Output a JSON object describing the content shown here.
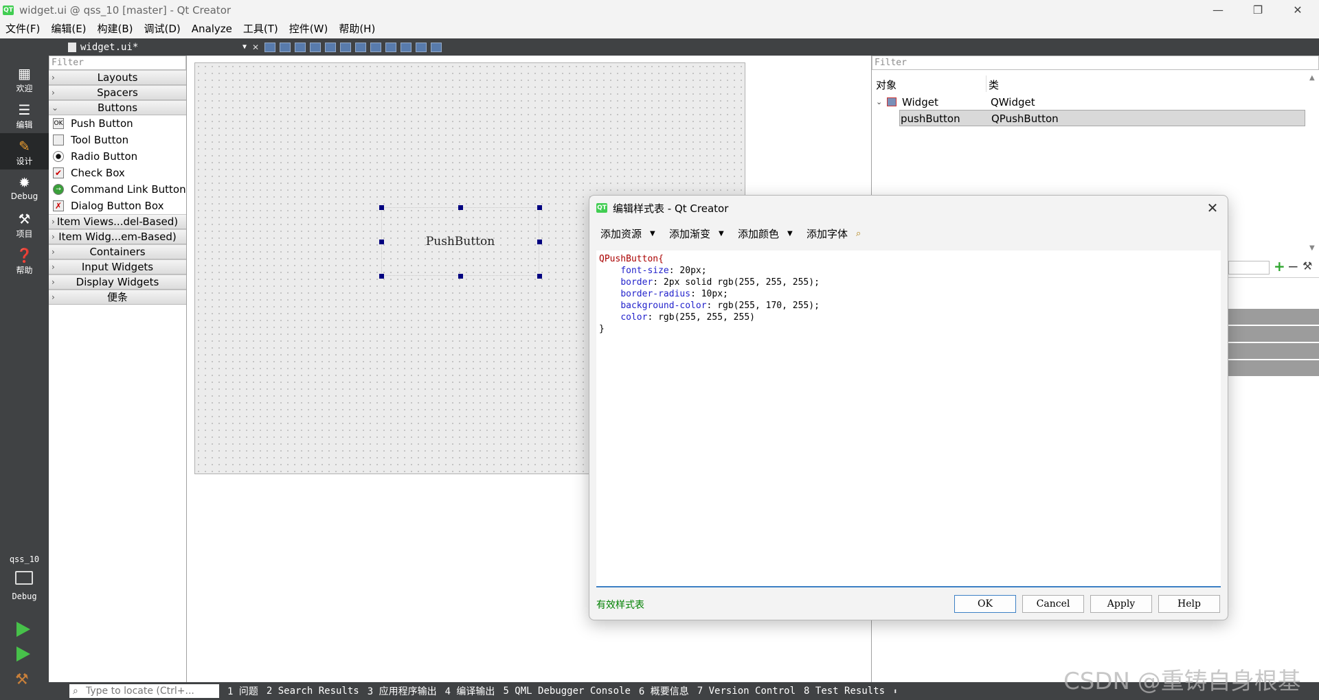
{
  "window": {
    "title": "widget.ui @ qss_10 [master] - Qt Creator",
    "logo": "QT"
  },
  "menu": [
    "文件(F)",
    "编辑(E)",
    "构建(B)",
    "调试(D)",
    "Analyze",
    "工具(T)",
    "控件(W)",
    "帮助(H)"
  ],
  "modes": [
    {
      "label": "欢迎",
      "icon": "welcome-icon"
    },
    {
      "label": "编辑",
      "icon": "edit-icon"
    },
    {
      "label": "设计",
      "icon": "design-icon"
    },
    {
      "label": "Debug",
      "icon": "debug-icon"
    },
    {
      "label": "项目",
      "icon": "projects-icon"
    },
    {
      "label": "帮助",
      "icon": "help-icon"
    }
  ],
  "kit": {
    "project": "qss_10",
    "config": "Debug"
  },
  "editor_tab": {
    "file": "widget.ui*"
  },
  "widget_box": {
    "filter_placeholder": "Filter",
    "categories_top": [
      "Layouts",
      "Spacers",
      "Buttons"
    ],
    "buttons": [
      "Push Button",
      "Tool Button",
      "Radio Button",
      "Check Box",
      "Command Link Button",
      "Dialog Button Box"
    ],
    "button_icon_labels": [
      "OK",
      "",
      "",
      "",
      "",
      ""
    ],
    "categories_bottom": [
      "Item Views...del-Based)",
      "Item Widg...em-Based)",
      "Containers",
      "Input Widgets",
      "Display Widgets",
      "便条"
    ]
  },
  "form": {
    "pushbutton_text": "PushButton"
  },
  "object_inspector": {
    "filter_placeholder": "Filter",
    "col_object": "对象",
    "col_class": "类",
    "rows": [
      {
        "object": "Widget",
        "class": "QWidget"
      },
      {
        "object": "pushButton",
        "class": "QPushButton"
      }
    ]
  },
  "dialog": {
    "logo": "QT",
    "title": "编辑样式表 - Qt Creator",
    "tools": [
      "添加资源",
      "添加渐变",
      "添加颜色",
      "添加字体"
    ],
    "code": {
      "selector": "QPushButton{",
      "lines": [
        {
          "prop": "font-size",
          "value": ": 20px;"
        },
        {
          "prop": "border",
          "value": ": 2px solid rgb(255, 255, 255);"
        },
        {
          "prop": "border-radius",
          "value": ": 10px;"
        },
        {
          "prop": "background-color",
          "value": ": rgb(255, 170, 255);"
        },
        {
          "prop": "color",
          "value": ": rgb(255, 255, 255)"
        }
      ],
      "close": "}"
    },
    "valid_label": "有效样式表",
    "buttons": {
      "ok": "OK",
      "cancel": "Cancel",
      "apply": "Apply",
      "help": "Help"
    }
  },
  "statusbar": {
    "locator_placeholder": "Type to locate (Ctrl+...",
    "panes": [
      "1 问题",
      "2 Search Results",
      "3 应用程序输出",
      "4 编译输出",
      "5 QML Debugger Console",
      "6 概要信息",
      "7 Version Control",
      "8 Test Results"
    ]
  },
  "watermark": "CSDN @重铸自身根基",
  "colors": {
    "sidebar": "#404244",
    "accent": "#3b7fc4",
    "valid": "#008000",
    "handle": "#000080"
  }
}
